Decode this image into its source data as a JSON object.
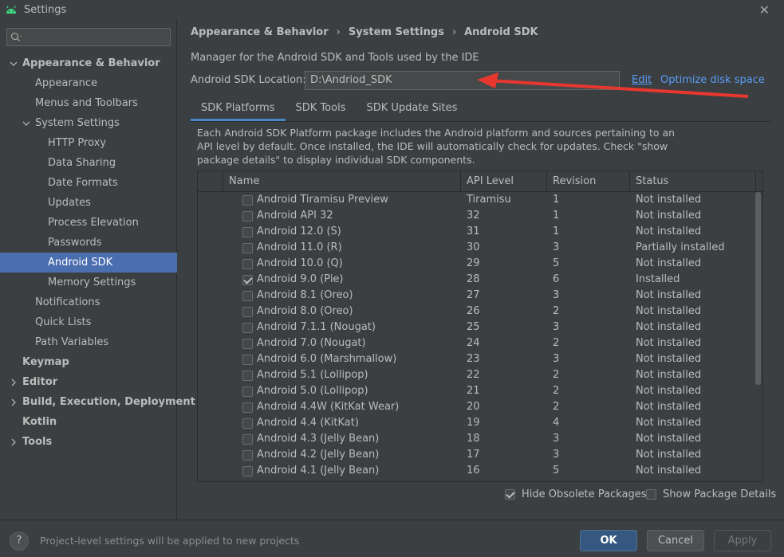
{
  "window": {
    "title": "Settings"
  },
  "search": {
    "placeholder": ""
  },
  "sidebar": {
    "items": [
      {
        "label": "Appearance & Behavior",
        "level": 0,
        "bold": true,
        "arrow": "down"
      },
      {
        "label": "Appearance",
        "level": 1
      },
      {
        "label": "Menus and Toolbars",
        "level": 1
      },
      {
        "label": "System Settings",
        "level": 1,
        "arrow": "down"
      },
      {
        "label": "HTTP Proxy",
        "level": 2
      },
      {
        "label": "Data Sharing",
        "level": 2
      },
      {
        "label": "Date Formats",
        "level": 2
      },
      {
        "label": "Updates",
        "level": 2
      },
      {
        "label": "Process Elevation",
        "level": 2
      },
      {
        "label": "Passwords",
        "level": 2
      },
      {
        "label": "Android SDK",
        "level": 2,
        "selected": true
      },
      {
        "label": "Memory Settings",
        "level": 2
      },
      {
        "label": "Notifications",
        "level": 1
      },
      {
        "label": "Quick Lists",
        "level": 1
      },
      {
        "label": "Path Variables",
        "level": 1
      },
      {
        "label": "Keymap",
        "level": 0,
        "bold": true
      },
      {
        "label": "Editor",
        "level": 0,
        "bold": true,
        "arrow": "right"
      },
      {
        "label": "Build, Execution, Deployment",
        "level": 0,
        "bold": true,
        "arrow": "right"
      },
      {
        "label": "Kotlin",
        "level": 0,
        "bold": true
      },
      {
        "label": "Tools",
        "level": 0,
        "bold": true,
        "arrow": "right"
      }
    ]
  },
  "breadcrumb": {
    "items": [
      "Appearance & Behavior",
      "System Settings",
      "Android SDK"
    ],
    "separator": "›"
  },
  "main": {
    "description": "Manager for the Android SDK and Tools used by the IDE",
    "location_label": "Android SDK Location:",
    "location_value": "D:\\Andriod_SDK",
    "edit_label": "Edit",
    "optimize_label": "Optimize disk space",
    "tabs": [
      "SDK Platforms",
      "SDK Tools",
      "SDK Update Sites"
    ],
    "platform_description": "Each Android SDK Platform package includes the Android platform and sources pertaining to an API level by default. Once installed, the IDE will automatically check for updates. Check \"show package details\" to display individual SDK components."
  },
  "table": {
    "headers": [
      "Name",
      "API Level",
      "Revision",
      "Status"
    ],
    "rows": [
      {
        "checked": false,
        "name": "Android Tiramisu Preview",
        "api": "Tiramisu",
        "rev": "1",
        "status": "Not installed"
      },
      {
        "checked": false,
        "name": "Android API 32",
        "api": "32",
        "rev": "1",
        "status": "Not installed"
      },
      {
        "checked": false,
        "name": "Android 12.0 (S)",
        "api": "31",
        "rev": "1",
        "status": "Not installed"
      },
      {
        "checked": false,
        "name": "Android 11.0 (R)",
        "api": "30",
        "rev": "3",
        "status": "Partially installed"
      },
      {
        "checked": false,
        "name": "Android 10.0 (Q)",
        "api": "29",
        "rev": "5",
        "status": "Not installed"
      },
      {
        "checked": true,
        "name": "Android 9.0 (Pie)",
        "api": "28",
        "rev": "6",
        "status": "Installed"
      },
      {
        "checked": false,
        "name": "Android 8.1 (Oreo)",
        "api": "27",
        "rev": "3",
        "status": "Not installed"
      },
      {
        "checked": false,
        "name": "Android 8.0 (Oreo)",
        "api": "26",
        "rev": "2",
        "status": "Not installed"
      },
      {
        "checked": false,
        "name": "Android 7.1.1 (Nougat)",
        "api": "25",
        "rev": "3",
        "status": "Not installed"
      },
      {
        "checked": false,
        "name": "Android 7.0 (Nougat)",
        "api": "24",
        "rev": "2",
        "status": "Not installed"
      },
      {
        "checked": false,
        "name": "Android 6.0 (Marshmallow)",
        "api": "23",
        "rev": "3",
        "status": "Not installed"
      },
      {
        "checked": false,
        "name": "Android 5.1 (Lollipop)",
        "api": "22",
        "rev": "2",
        "status": "Not installed"
      },
      {
        "checked": false,
        "name": "Android 5.0 (Lollipop)",
        "api": "21",
        "rev": "2",
        "status": "Not installed"
      },
      {
        "checked": false,
        "name": "Android 4.4W (KitKat Wear)",
        "api": "20",
        "rev": "2",
        "status": "Not installed"
      },
      {
        "checked": false,
        "name": "Android 4.4 (KitKat)",
        "api": "19",
        "rev": "4",
        "status": "Not installed"
      },
      {
        "checked": false,
        "name": "Android 4.3 (Jelly Bean)",
        "api": "18",
        "rev": "3",
        "status": "Not installed"
      },
      {
        "checked": false,
        "name": "Android 4.2 (Jelly Bean)",
        "api": "17",
        "rev": "3",
        "status": "Not installed"
      },
      {
        "checked": false,
        "name": "Android 4.1 (Jelly Bean)",
        "api": "16",
        "rev": "5",
        "status": "Not installed"
      }
    ]
  },
  "options": {
    "hide_obsolete_label": "Hide Obsolete Packages",
    "hide_obsolete_checked": true,
    "show_details_label": "Show Package Details",
    "show_details_checked": false
  },
  "footer": {
    "help_label": "?",
    "text": "Project-level settings will be applied to new projects",
    "ok_label": "OK",
    "cancel_label": "Cancel",
    "apply_label": "Apply"
  },
  "colors": {
    "background": "#3c3f41",
    "selection": "#4b6eaf",
    "link": "#589df6",
    "annotation_arrow": "#e8372f"
  }
}
